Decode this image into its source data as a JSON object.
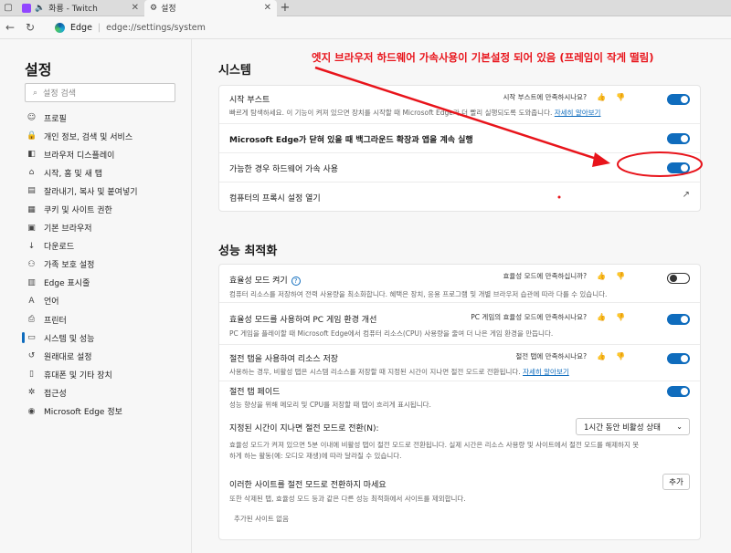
{
  "tabs": [
    {
      "title": "화룡 - Twitch",
      "active": false
    },
    {
      "title": "설정",
      "active": true
    }
  ],
  "address": {
    "site": "Edge",
    "url": "edge://settings/system"
  },
  "sidebar": {
    "title": "설정",
    "search_placeholder": "설정 검색",
    "items": [
      {
        "label": "프로필",
        "icon": "profile-icon"
      },
      {
        "label": "개인 정보, 검색 및 서비스",
        "icon": "lock-icon"
      },
      {
        "label": "브라우저 디스플레이",
        "icon": "display-icon"
      },
      {
        "label": "시작, 홈 및 새 탭",
        "icon": "home-icon"
      },
      {
        "label": "잘라내기, 복사 및 붙여넣기",
        "icon": "clipboard-icon"
      },
      {
        "label": "쿠키 및 사이트 권한",
        "icon": "cookie-icon"
      },
      {
        "label": "기본 브라우저",
        "icon": "browser-icon"
      },
      {
        "label": "다운로드",
        "icon": "download-icon"
      },
      {
        "label": "가족 보호 설정",
        "icon": "family-icon"
      },
      {
        "label": "Edge 표시줄",
        "icon": "edgebar-icon"
      },
      {
        "label": "언어",
        "icon": "language-icon"
      },
      {
        "label": "프린터",
        "icon": "printer-icon"
      },
      {
        "label": "시스템 및 성능",
        "icon": "system-icon",
        "active": true
      },
      {
        "label": "원래대로 설정",
        "icon": "reset-icon"
      },
      {
        "label": "휴대폰 및 기타 장치",
        "icon": "phone-icon"
      },
      {
        "label": "접근성",
        "icon": "accessibility-icon"
      },
      {
        "label": "Microsoft Edge 정보",
        "icon": "edge-icon"
      }
    ]
  },
  "system": {
    "title": "시스템",
    "startup_boost": {
      "title": "시작 부스트",
      "desc": "빠르게 탐색하세요. 이 기능이 켜져 있으면 장치를 시작할 때 Microsoft Edge가 더 빨리 실행되도록 도와줍니다.",
      "link": "자세히 알아보기",
      "feedback": "시작 부스트에 만족하시나요?"
    },
    "background_title": "Microsoft Edge가 닫혀 있을 때 백그라운드 확장과 앱을 계속 실행",
    "hw_accel_title": "가능한 경우 하드웨어 가속 사용",
    "proxy_title": "컴퓨터의 프록시 설정 열기"
  },
  "performance": {
    "title": "성능 최적화",
    "efficiency": {
      "title": "효율성 모드 켜기",
      "desc": "컴퓨터 리소스를 저장하여 전력 사용량을 최소화합니다. 혜택은 장치, 응용 프로그램 및 개별 브라우저 습관에 따라 다를 수 있습니다.",
      "feedback": "효율성 모드에 만족하십니까?"
    },
    "gaming": {
      "title": "효율성 모드를 사용하여 PC 게임 환경 개선",
      "desc": "PC 게임을 플레이할 때 Microsoft Edge에서 컴퓨터 리소스(CPU) 사용량을 줄여 더 나은 게임 환경을 만듭니다.",
      "feedback": "PC 게임의 효율성 모드에 만족하시나요?"
    },
    "sleeping": {
      "title": "절전 탭을 사용하여 리소스 저장",
      "desc": "사용하는 경우, 비활성 탭은 시스템 리소스를 저장할 때 지정된 시간이 지나면 절전 모드로 전환됩니다.",
      "link": "자세히 알아보기",
      "feedback": "절전 탭에 만족하시나요?"
    },
    "fade": {
      "title": "절전 탭 페이드",
      "desc": "성능 향상을 위해 메모리 및 CPU를 저장할 때 탭이 흐리게 표시됩니다."
    },
    "timeout": {
      "title": "지정된 시간이 지나면 절전 모드로 전환(N):",
      "value": "1시간 동안 비활성 상태",
      "desc1": "효율성 모드가 켜져 있으면 5분 이내에 비활성 탭이 절전 모드로 전환됩니다. 실제 시간은 리소스 사용량 및 사이트에서 절전 모드를 해제하지 못",
      "desc2": "하게 하는 활동(예: 오디오 재생)에 따라 달라질 수 있습니다."
    },
    "never": {
      "title": "이러한 사이트를 절전 모드로 전환하지 마세요",
      "desc": "또한 삭제된 탭, 효율성 모드 등과 같은 다른 성능 최적화에서 사이트를 제외합니다.",
      "add": "추가",
      "empty": "추가된 사이트 없음"
    }
  },
  "annotation": "엣지 브라우저 하드웨어 가속사용이 기본설정 되어 있음 (프레임이 작게 떨림)",
  "colors": {
    "accent": "#0f6cbd",
    "annotation": "#e8141b"
  }
}
